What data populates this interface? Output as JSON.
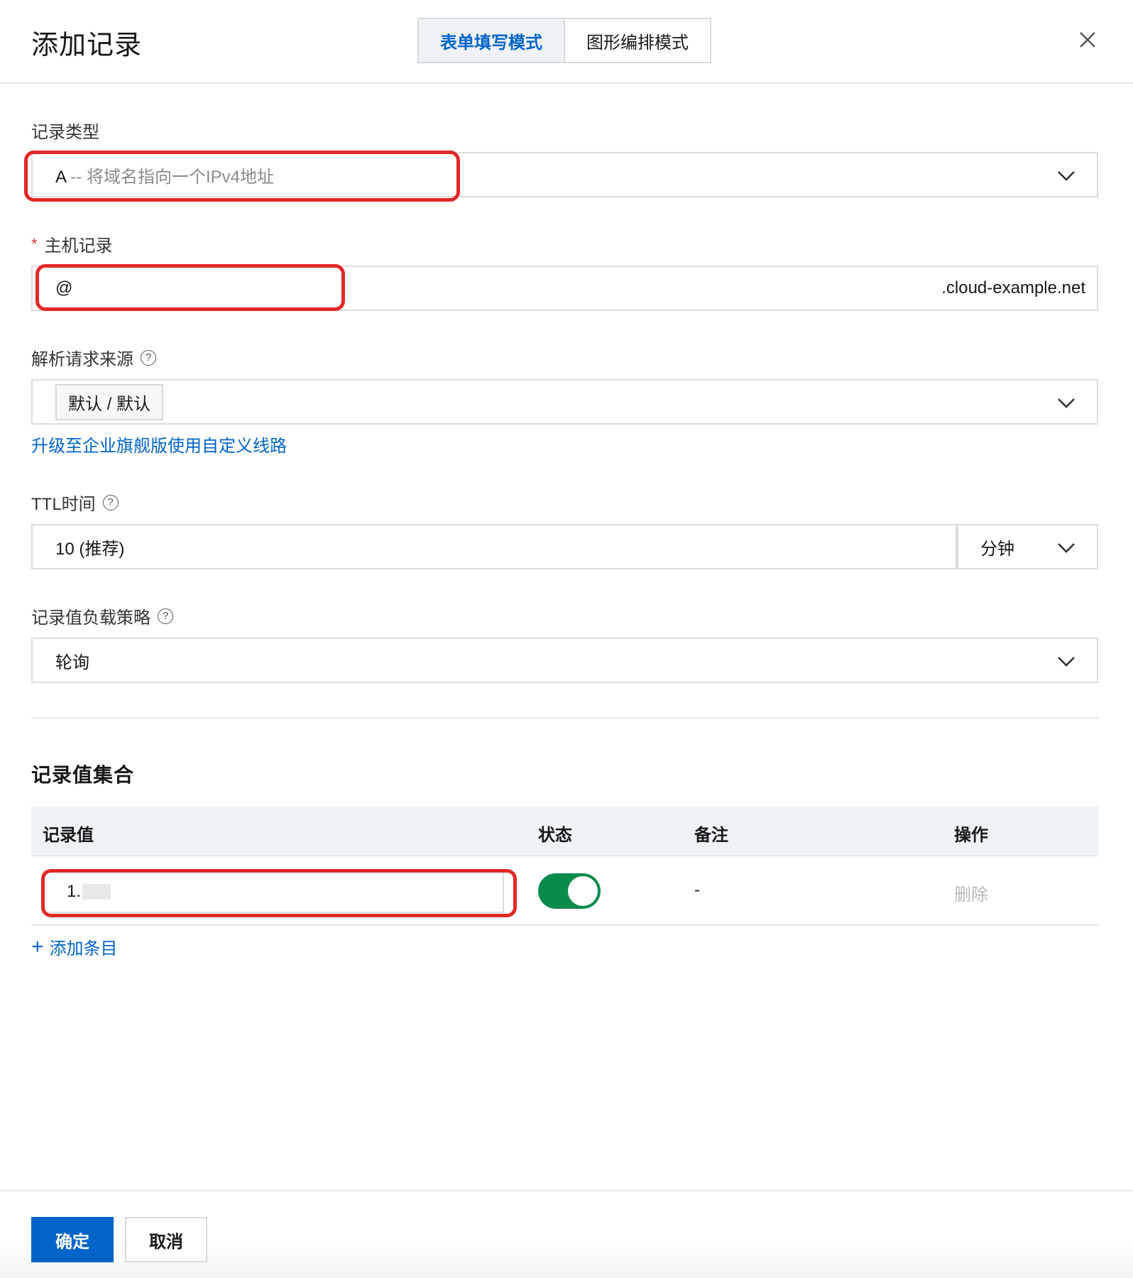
{
  "header": {
    "title": "添加记录",
    "modes": [
      "表单填写模式",
      "图形编排模式"
    ],
    "active_mode": "表单填写模式"
  },
  "record_type": {
    "label": "记录类型",
    "value_prefix": "A",
    "value_desc": "-- 将域名指向一个IPv4地址"
  },
  "host": {
    "required_mark": "*",
    "label": "主机记录",
    "value": "@",
    "suffix": ".cloud-example.net"
  },
  "resolve_source": {
    "label": "解析请求来源",
    "help": "?",
    "tag": "默认 / 默认",
    "upgrade_link": "升级至企业旗舰版使用自定义线路"
  },
  "ttl": {
    "label": "TTL时间",
    "help": "?",
    "value": "10 (推荐)",
    "unit": "分钟"
  },
  "load_strategy": {
    "label": "记录值负载策略",
    "help": "?",
    "value": "轮询"
  },
  "record_set": {
    "title": "记录值集合",
    "columns": [
      "记录值",
      "状态",
      "备注",
      "操作"
    ],
    "rows": [
      {
        "value": "1.",
        "status_on": true,
        "remark": "-",
        "action": "删除"
      }
    ],
    "add_item": "添加条目"
  },
  "footer": {
    "confirm": "确定",
    "cancel": "取消"
  },
  "colors": {
    "accent": "#0064c8",
    "toggle_on": "#0a8b4c",
    "annotation": "#e02828"
  }
}
